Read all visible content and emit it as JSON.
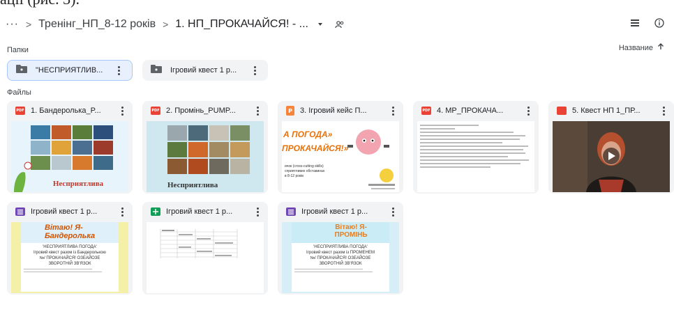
{
  "top_fragment": "ації (рис. 3).",
  "breadcrumb": {
    "more": "···",
    "parent": "Тренінг_НП_8-12 років",
    "current": "1. НП_ПРОКАЧАЙСЯ! - ..."
  },
  "sections": {
    "folders_label": "Папки",
    "files_label": "Файлы",
    "sort_label": "Название"
  },
  "folders": [
    {
      "name": "\"НЕСПРИЯТЛИВ...",
      "selected": true
    },
    {
      "name": "Ігровий квест 1 р...",
      "selected": false
    }
  ],
  "files": [
    {
      "type": "PDF",
      "title": "1. Бандеролька_P...",
      "thumb_caption": "Несприятлива"
    },
    {
      "type": "PDF",
      "title": "2. Промінь_PUMP...",
      "thumb_caption": "Несприятлива"
    },
    {
      "type": "P",
      "title": "3. Ігровий кейс П...",
      "thumb_lines": [
        "А ПОГОДА»",
        "ПРОКАЧАЙСЯ!»",
        "ичок (cross-cutting skills)",
        "сприятливих обставинах",
        "в 8-12 років"
      ]
    },
    {
      "type": "PDF",
      "title": "4. МР_ПРОКАЧА...",
      "thumb_caption": ""
    },
    {
      "type": "video",
      "title": "5. Квест НП 1_ПР...",
      "thumb_caption": ""
    },
    {
      "type": "form",
      "title": "Ігровий квест 1 р...",
      "thumb_banner": "Вітаю! Я- Бандеролька",
      "thumb_lines": [
        "'НЕСПРИЯТЛИВА ПОГОДА'",
        "Ігровий квест разом із Бандеролькою",
        "№/ ПРОКАЧАЙСЯ! ОЗЕАЙОЗЕ",
        "ЗВОРОТНІЙ ЗВ'ЯЗОК"
      ]
    },
    {
      "type": "sheet",
      "title": "Ігровий квест 1 р...",
      "thumb_caption": ""
    },
    {
      "type": "form",
      "title": "Ігровий квест 1 р...",
      "thumb_banner": "Вітаю! Я- ПРОМІНЬ",
      "thumb_lines": [
        "'НЕСПРИЯТЛИВА ПОГОДА'",
        "Ігровий квест разом із ПРОМЕНЕМ",
        "№/ ПРОКАЧАЙСЯ! ОЗЕАЙОЗЕ",
        "ЗВОРОТНІЙ ЗВ'ЯЗОК"
      ]
    }
  ],
  "icons": {
    "dropdown": "caret-down-icon",
    "share": "shared-people-icon",
    "view": "list-view-icon",
    "info": "info-icon",
    "sort": "arrow-up-icon"
  }
}
